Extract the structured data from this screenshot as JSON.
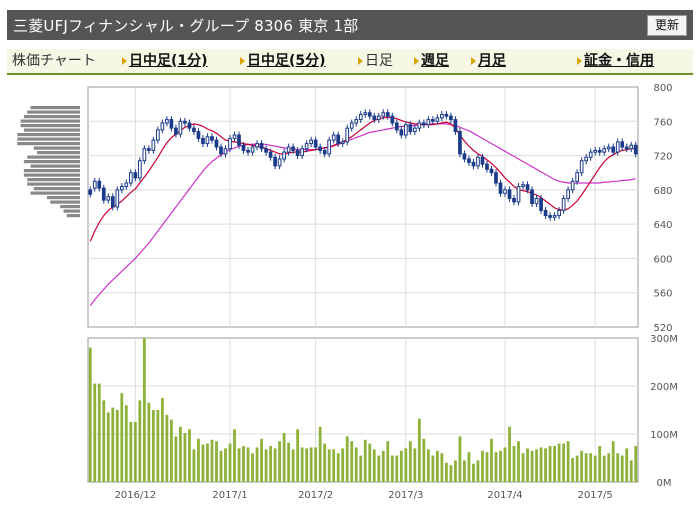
{
  "header": {
    "title": "三菱UFJフィナンシャル・グループ 8306 東京 1部",
    "refresh_label": "更新"
  },
  "tabs": [
    {
      "label": "株価チャート",
      "link": false,
      "arrow": false
    },
    {
      "label": "日中足(1分)",
      "link": true,
      "arrow": true
    },
    {
      "label": "日中足(5分)",
      "link": true,
      "arrow": true
    },
    {
      "label": "日足",
      "link": false,
      "arrow": true
    },
    {
      "label": "週足",
      "link": true,
      "arrow": true
    },
    {
      "label": "月足",
      "link": true,
      "arrow": true
    },
    {
      "label": "証金・信用",
      "link": true,
      "arrow": true
    }
  ],
  "colors": {
    "candle": "#1a3a8a",
    "ma_short": "#cc0033",
    "ma_long": "#cc33cc",
    "volume_bar": "#8db23a",
    "profile_bar": "#888888",
    "grid": "#dddddd",
    "frame": "#999999",
    "axis_text": "#555555"
  },
  "chart_data": {
    "type": "candlestick",
    "price_axis": {
      "ticks": [
        520,
        560,
        600,
        640,
        680,
        720,
        760,
        800
      ],
      "ylim": [
        520,
        800
      ]
    },
    "volume_axis": {
      "ticks": [
        "0M",
        "100M",
        "200M",
        "300M"
      ],
      "ylim": [
        0,
        300
      ]
    },
    "x_tick_labels": [
      {
        "label": "2016/12",
        "index": 10
      },
      {
        "label": "2017/1",
        "index": 31
      },
      {
        "label": "2017/2",
        "index": 50
      },
      {
        "label": "2017/3",
        "index": 70
      },
      {
        "label": "2017/4",
        "index": 92
      },
      {
        "label": "2017/5",
        "index": 112
      }
    ],
    "close": [
      675,
      690,
      682,
      668,
      672,
      660,
      680,
      684,
      688,
      700,
      694,
      714,
      728,
      726,
      738,
      750,
      758,
      762,
      752,
      745,
      760,
      758,
      752,
      748,
      740,
      734,
      742,
      738,
      730,
      722,
      728,
      740,
      744,
      732,
      726,
      724,
      730,
      734,
      728,
      724,
      718,
      708,
      716,
      724,
      730,
      726,
      720,
      728,
      734,
      738,
      730,
      726,
      722,
      738,
      744,
      734,
      736,
      752,
      758,
      762,
      768,
      770,
      766,
      762,
      766,
      770,
      766,
      758,
      750,
      744,
      756,
      748,
      752,
      758,
      756,
      762,
      760,
      764,
      768,
      766,
      762,
      748,
      722,
      716,
      712,
      708,
      718,
      710,
      704,
      700,
      688,
      676,
      680,
      670,
      666,
      684,
      686,
      680,
      664,
      670,
      656,
      650,
      648,
      650,
      656,
      670,
      680,
      690,
      700,
      714,
      718,
      724,
      726,
      724,
      728,
      730,
      724,
      736,
      730,
      728,
      732,
      722
    ],
    "open": [
      680,
      682,
      690,
      682,
      668,
      672,
      660,
      680,
      684,
      688,
      700,
      694,
      714,
      728,
      726,
      738,
      750,
      758,
      762,
      752,
      745,
      760,
      758,
      752,
      748,
      740,
      734,
      742,
      738,
      730,
      722,
      728,
      740,
      744,
      732,
      726,
      724,
      730,
      734,
      728,
      724,
      718,
      708,
      716,
      724,
      730,
      726,
      720,
      728,
      734,
      738,
      730,
      726,
      722,
      738,
      744,
      734,
      736,
      752,
      758,
      762,
      768,
      770,
      766,
      762,
      766,
      770,
      766,
      758,
      750,
      744,
      756,
      748,
      752,
      758,
      756,
      762,
      760,
      764,
      768,
      766,
      762,
      748,
      722,
      716,
      712,
      708,
      718,
      710,
      704,
      700,
      688,
      676,
      680,
      670,
      666,
      684,
      686,
      680,
      664,
      670,
      656,
      650,
      648,
      650,
      656,
      670,
      680,
      690,
      700,
      714,
      718,
      724,
      726,
      724,
      728,
      730,
      724,
      736,
      730,
      728,
      732
    ],
    "volume": [
      280,
      205,
      205,
      170,
      145,
      155,
      150,
      185,
      160,
      125,
      125,
      170,
      300,
      165,
      150,
      150,
      175,
      140,
      130,
      95,
      115,
      102,
      110,
      68,
      90,
      78,
      80,
      88,
      85,
      65,
      70,
      80,
      110,
      70,
      75,
      72,
      60,
      72,
      90,
      68,
      75,
      70,
      85,
      102,
      82,
      68,
      110,
      72,
      70,
      72,
      72,
      115,
      80,
      68,
      68,
      60,
      70,
      95,
      85,
      72,
      55,
      88,
      80,
      68,
      55,
      65,
      85,
      55,
      55,
      65,
      70,
      85,
      70,
      132,
      90,
      68,
      55,
      65,
      60,
      40,
      35,
      45,
      95,
      45,
      62,
      38,
      45,
      65,
      62,
      90,
      62,
      65,
      72,
      115,
      75,
      85,
      60,
      70,
      65,
      68,
      72,
      70,
      75,
      75,
      80,
      80,
      85,
      50,
      55,
      65,
      60,
      60,
      55,
      75,
      55,
      60,
      85,
      60,
      55,
      70,
      45,
      75
    ],
    "ma_short": [
      620,
      632,
      642,
      650,
      656,
      660,
      663,
      667,
      672,
      677,
      681,
      688,
      695,
      702,
      710,
      718,
      727,
      735,
      741,
      745,
      749,
      753,
      755,
      757,
      756,
      754,
      751,
      749,
      746,
      742,
      738,
      737,
      736,
      735,
      734,
      733,
      732,
      731,
      730,
      728,
      726,
      724,
      722,
      722,
      723,
      724,
      724,
      724,
      725,
      726,
      727,
      728,
      729,
      730,
      732,
      734,
      736,
      739,
      742,
      746,
      750,
      754,
      758,
      761,
      763,
      764,
      765,
      764,
      763,
      761,
      759,
      758,
      757,
      757,
      756,
      756,
      756,
      757,
      758,
      759,
      757,
      752,
      744,
      737,
      731,
      726,
      722,
      719,
      715,
      711,
      706,
      700,
      694,
      689,
      684,
      680,
      679,
      678,
      676,
      674,
      671,
      667,
      663,
      659,
      657,
      656,
      658,
      662,
      667,
      674,
      682,
      690,
      698,
      706,
      713,
      718,
      721,
      724,
      726,
      727,
      728,
      728
    ],
    "ma_long": [
      545,
      552,
      558,
      564,
      570,
      575,
      580,
      585,
      590,
      595,
      600,
      606,
      612,
      618,
      625,
      632,
      639,
      646,
      653,
      660,
      667,
      674,
      681,
      688,
      695,
      702,
      708,
      713,
      717,
      721,
      724,
      727,
      729,
      731,
      732,
      733,
      733,
      733,
      733,
      733,
      732,
      731,
      730,
      729,
      728,
      728,
      727,
      727,
      727,
      727,
      727,
      728,
      729,
      730,
      731,
      733,
      735,
      737,
      739,
      741,
      743,
      745,
      747,
      748,
      749,
      750,
      751,
      752,
      753,
      754,
      754,
      755,
      755,
      756,
      756,
      757,
      757,
      757,
      757,
      757,
      756,
      755,
      753,
      751,
      749,
      746,
      743,
      740,
      737,
      734,
      731,
      728,
      725,
      722,
      719,
      716,
      713,
      710,
      707,
      704,
      701,
      698,
      695,
      692,
      690,
      689,
      688,
      688,
      688,
      688,
      688,
      688,
      688,
      688,
      689,
      689,
      690,
      690,
      691,
      691,
      692,
      693
    ],
    "volume_profile": [
      15,
      16,
      17,
      18,
      18,
      17,
      19,
      19,
      19,
      14,
      13,
      16,
      17,
      15,
      17,
      17,
      16,
      16,
      14,
      15,
      10,
      9,
      6,
      5,
      4
    ]
  }
}
